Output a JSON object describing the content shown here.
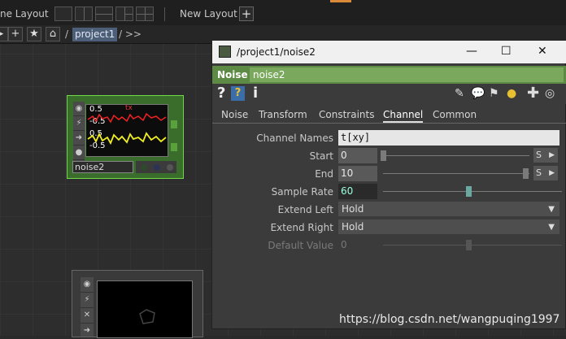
{
  "topbar": {
    "pane_layout_label": "ne Layout",
    "new_layout_label": "New Layout",
    "add_label": "+"
  },
  "pathbar": {
    "add_label": "+",
    "star_label": "★",
    "home_label": "⌂",
    "slash1": "/",
    "crumb": "project1",
    "trail": "/  >>"
  },
  "node": {
    "name": "noise2",
    "preview": {
      "channel": "tx",
      "v1": "0.5",
      "v2": "-0.5",
      "v3": "0.5",
      "v4": "-0.5"
    },
    "flag_colors": [
      "#2f4a2a",
      "#2b3356",
      "#3b3b3b"
    ]
  },
  "panel": {
    "title": "/project1/noise2",
    "window_controls": {
      "minimize": "—",
      "maximize": "☐",
      "close": "✕"
    },
    "op_type": "Noise",
    "op_name": "noise2",
    "help": "?",
    "info": "i",
    "tabs": [
      "Noise",
      "Transform",
      "Constraints",
      "Channel",
      "Common"
    ],
    "active_tab": "Channel",
    "params": {
      "channel_names": {
        "label": "Channel Names",
        "value": "t[xy]"
      },
      "start": {
        "label": "Start",
        "value": "0",
        "unit": "S"
      },
      "end": {
        "label": "End",
        "value": "10",
        "unit": "S"
      },
      "sample_rate": {
        "label": "Sample Rate",
        "value": "60"
      },
      "extend_left": {
        "label": "Extend Left",
        "value": "Hold"
      },
      "extend_right": {
        "label": "Extend Right",
        "value": "Hold"
      },
      "default_value": {
        "label": "Default Value",
        "value": "0"
      }
    }
  },
  "watermark": "https://blog.csdn.net/wangpuqing1997",
  "colors": {
    "op_bar": "#5d8b45",
    "op_name_bg": "#7aa95d",
    "node_border": "#6fd94a",
    "crumb_bg": "#4d5f78"
  }
}
